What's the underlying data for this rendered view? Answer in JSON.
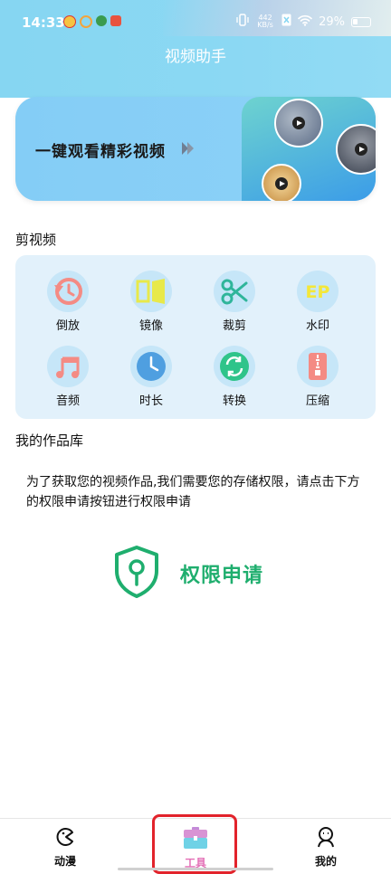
{
  "status_bar": {
    "time": "14:33",
    "net_speed": "442",
    "net_unit": "KB/s",
    "battery": "29%"
  },
  "header": {
    "title": "视频助手"
  },
  "banner": {
    "text": "一键观看精彩视频"
  },
  "edit_section": {
    "title": "剪视频",
    "tools": [
      {
        "label": "倒放",
        "icon": "rewind-icon",
        "color": "#f48b84"
      },
      {
        "label": "镜像",
        "icon": "mirror-icon",
        "color": "#e8e94a"
      },
      {
        "label": "裁剪",
        "icon": "scissors-icon",
        "color": "#2fb59a"
      },
      {
        "label": "水印",
        "icon": "watermark-icon",
        "color": "#f3e73a"
      },
      {
        "label": "音频",
        "icon": "music-icon",
        "color": "#f48b84"
      },
      {
        "label": "时长",
        "icon": "clock-icon",
        "color": "#4f9fe0"
      },
      {
        "label": "转换",
        "icon": "convert-icon",
        "color": "#2fc48a"
      },
      {
        "label": "压缩",
        "icon": "zip-icon",
        "color": "#f48b84"
      }
    ]
  },
  "library_section": {
    "title": "我的作品库",
    "permission_text": "为了获取您的视频作品,我们需要您的存储权限，请点击下方的权限申请按钮进行权限申请",
    "permission_button": "权限申请"
  },
  "tabbar": {
    "tabs": [
      {
        "label": "动漫",
        "icon": "pacman-icon"
      },
      {
        "label": "工具",
        "icon": "toolbox-icon",
        "active": true
      },
      {
        "label": "我的",
        "icon": "person-icon"
      }
    ]
  },
  "colors": {
    "header": "#8bd8f3",
    "accent_green": "#1fae6e",
    "tab_active": "#e36fb6",
    "highlight_box": "#e2232b"
  }
}
